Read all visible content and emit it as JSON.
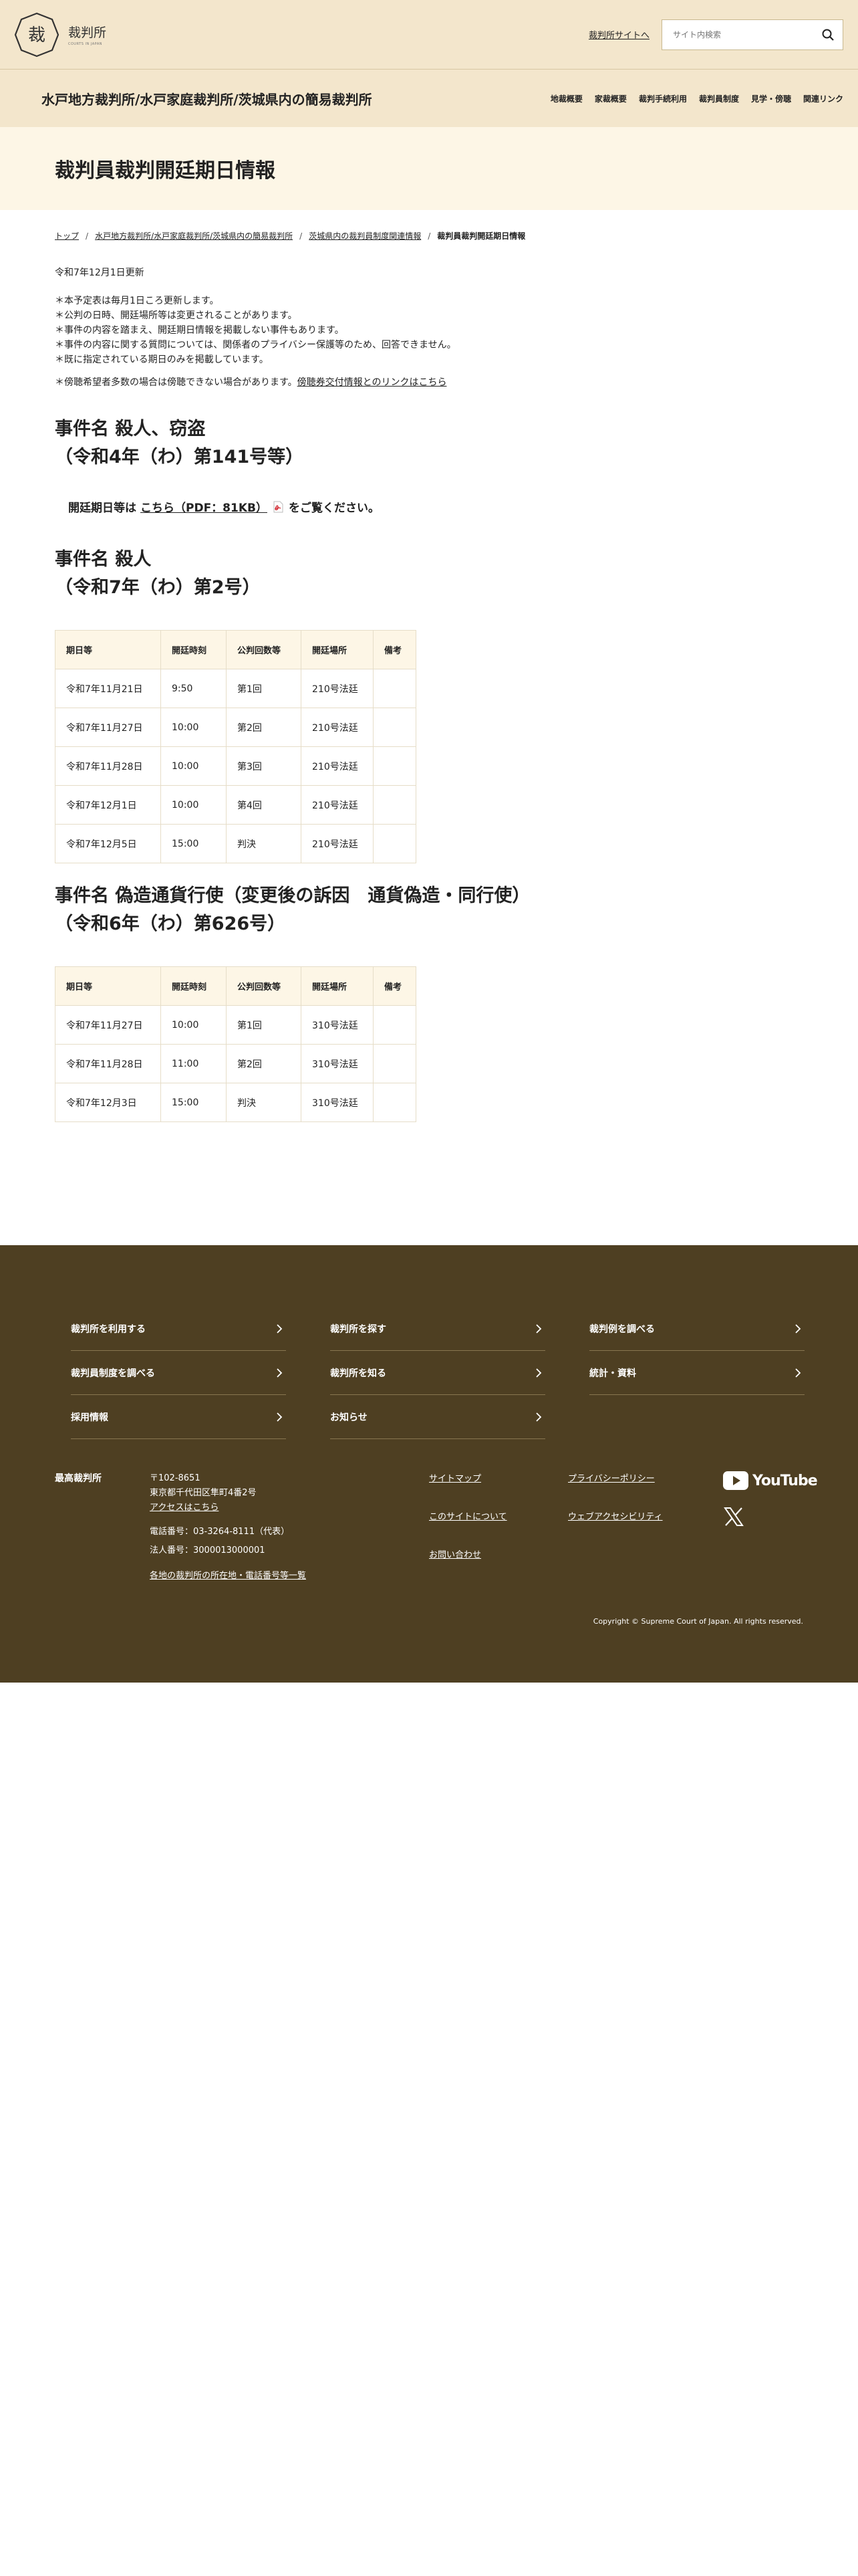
{
  "header": {
    "logo_text": "裁判所",
    "logo_subtext": "COURTS IN JAPAN",
    "portal_link": "裁判所サイトへ",
    "search_placeholder": "サイト内検索",
    "court_name": "水戸地方裁判所/水戸家庭裁判所/茨城県内の簡易裁判所",
    "nav": [
      "地裁概要",
      "家裁概要",
      "裁判手続利用",
      "裁判員制度",
      "見学・傍聴",
      "関連リンク"
    ]
  },
  "page_title": "裁判員裁判開廷期日情報",
  "breadcrumb": [
    "トップ",
    "水戸地方裁判所/水戸家庭裁判所/茨城県内の簡易裁判所",
    "茨城県内の裁判員制度関連情報",
    "裁判員裁判開廷期日情報"
  ],
  "updated": "令和7年12月1日更新",
  "notes": [
    "＊本予定表は毎月1日ころ更新します。",
    "＊公判の日時、開廷場所等は変更されることがあります。",
    "＊事件の内容を踏まえ、開廷期日情報を掲載しない事件もあります。",
    "＊事件の内容に関する質問については、関係者のプライバシー保護等のため、回答できません。",
    "＊既に指定されている期日のみを掲載しています。"
  ],
  "ticket_note": {
    "text": "＊傍聴希望者多数の場合は傍聴できない場合があります。",
    "link": "傍聴券交付情報とのリンクはこちら"
  },
  "table_headers": [
    "期日等",
    "開廷時刻",
    "公判回数等",
    "開廷場所",
    "備考"
  ],
  "cases": [
    {
      "title_line1": "事件名 殺人、窃盗",
      "title_line2": "（令和4年（わ）第141号等）",
      "pdf_prefix": "開廷期日等は",
      "pdf_link": "こちら（PDF：81KB）",
      "pdf_suffix": "をご覧ください。"
    },
    {
      "title_line1": "事件名 殺人",
      "title_line2": "（令和7年（わ）第2号）",
      "rows": [
        [
          "令和7年11月21日",
          "9:50",
          "第1回",
          "210号法廷",
          ""
        ],
        [
          "令和7年11月27日",
          "10:00",
          "第2回",
          "210号法廷",
          ""
        ],
        [
          "令和7年11月28日",
          "10:00",
          "第3回",
          "210号法廷",
          ""
        ],
        [
          "令和7年12月1日",
          "10:00",
          "第4回",
          "210号法廷",
          ""
        ],
        [
          "令和7年12月5日",
          "15:00",
          "判決",
          "210号法廷",
          ""
        ]
      ]
    },
    {
      "title_line1": "事件名 偽造通貨行使（変更後の訴因　通貨偽造・同行使）",
      "title_line2": "（令和6年（わ）第626号）",
      "rows": [
        [
          "令和7年11月27日",
          "10:00",
          "第1回",
          "310号法廷",
          ""
        ],
        [
          "令和7年11月28日",
          "11:00",
          "第2回",
          "310号法廷",
          ""
        ],
        [
          "令和7年12月3日",
          "15:00",
          "判決",
          "310号法廷",
          ""
        ]
      ]
    }
  ],
  "footer": {
    "links": [
      "裁判所を利用する",
      "裁判所を探す",
      "裁判例を調べる",
      "裁判員制度を調べる",
      "裁判所を知る",
      "統計・資料",
      "採用情報",
      "お知らせ"
    ],
    "org_name": "最高裁判所",
    "postal": "〒102-8651",
    "address": "東京都千代田区隼町4番2号",
    "access": "アクセスはこちら",
    "phone": "電話番号：03-3264-8111（代表）",
    "corp_no": "法人番号：3000013000001",
    "all_courts": "各地の裁判所の所在地・電話番号等一覧",
    "col1": [
      "サイトマップ",
      "このサイトについて",
      "お問い合わせ"
    ],
    "col2": [
      "プライバシーポリシー",
      "ウェブアクセシビリティ"
    ],
    "youtube": "YouTube",
    "copyright": "Copyright © Supreme Court of Japan. All rights reserved."
  }
}
